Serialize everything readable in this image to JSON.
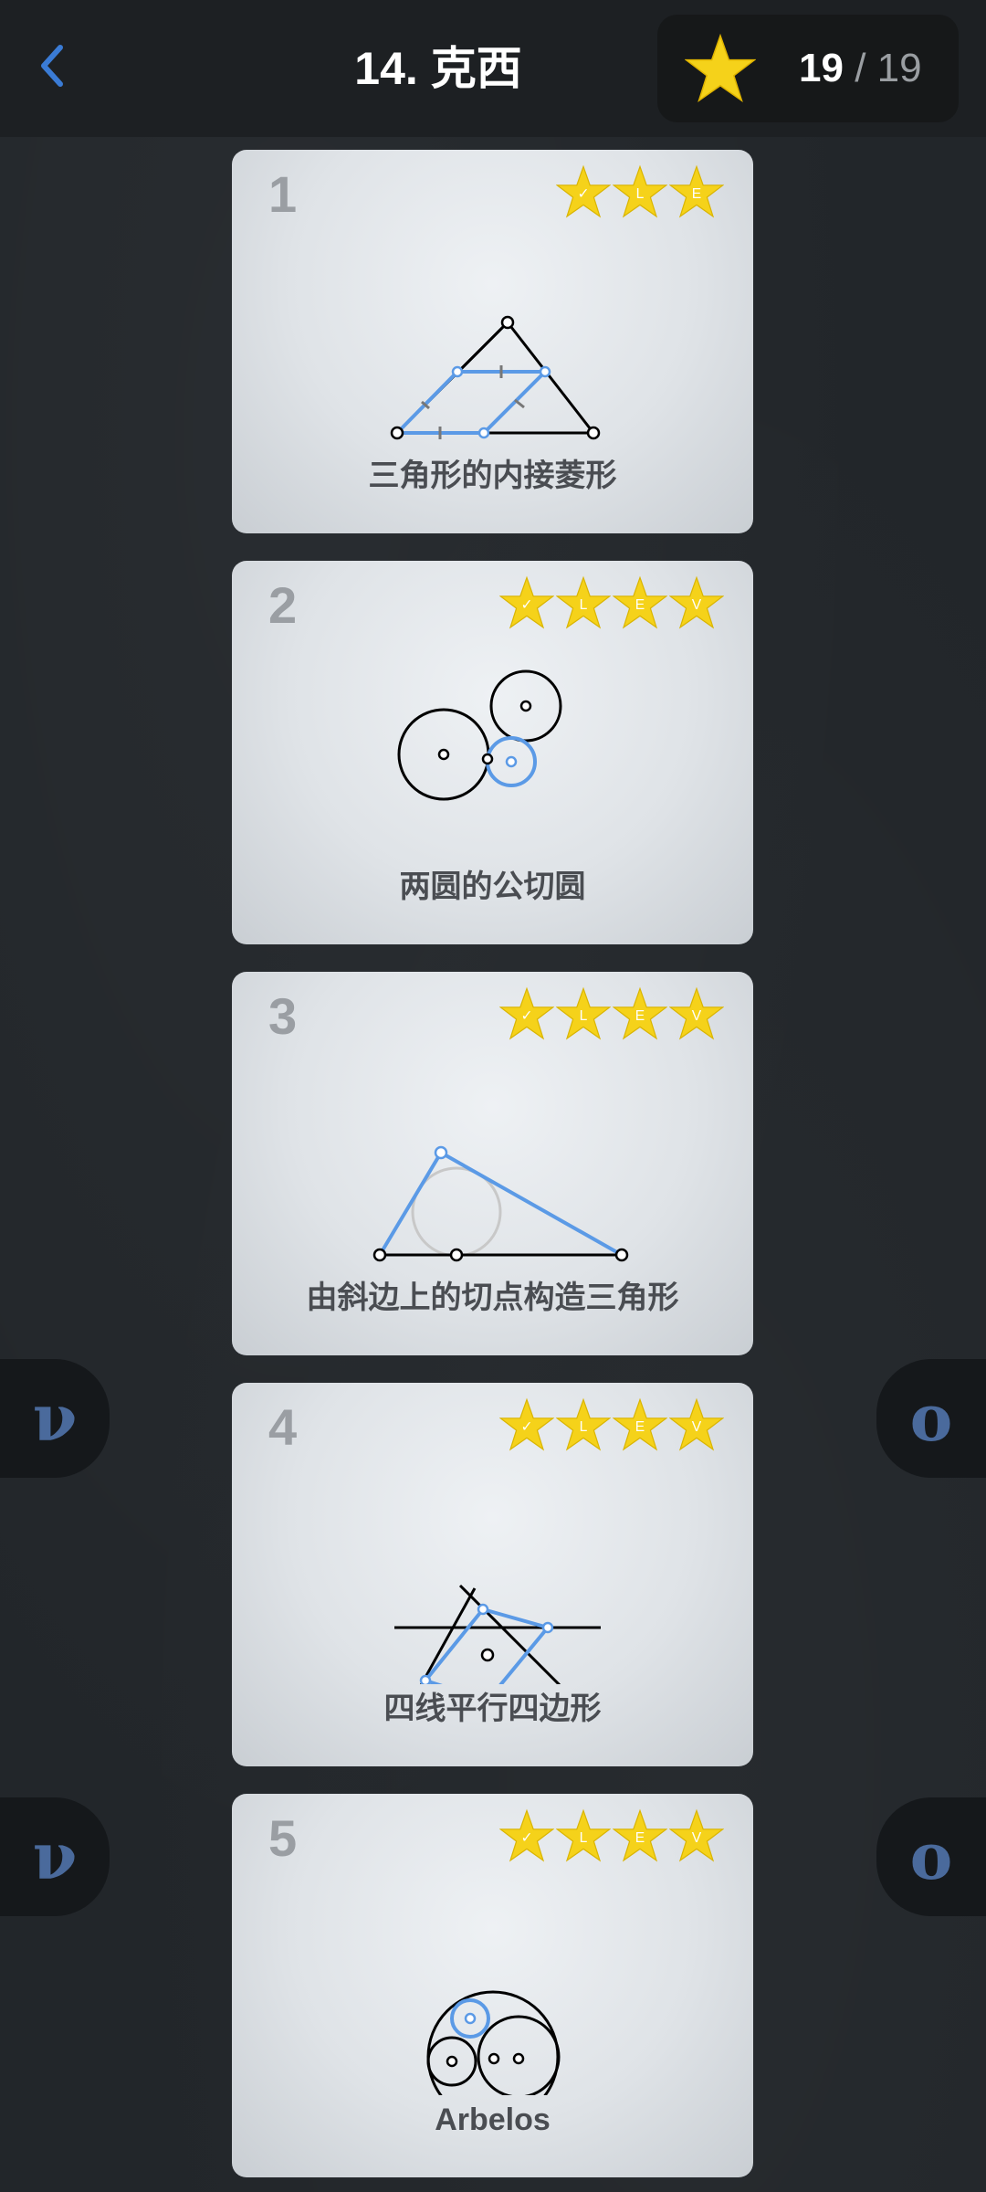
{
  "header": {
    "title": "14. 克西",
    "score_current": "19",
    "score_separator": "/",
    "score_total": "19"
  },
  "levels": [
    {
      "number": "1",
      "label": "三角形的内接菱形",
      "stars": [
        "✓",
        "L",
        "E"
      ]
    },
    {
      "number": "2",
      "label": "两圆的公切圆",
      "stars": [
        "✓",
        "L",
        "E",
        "V"
      ]
    },
    {
      "number": "3",
      "label": "由斜边上的切点构造三角形",
      "stars": [
        "✓",
        "L",
        "E",
        "V"
      ]
    },
    {
      "number": "4",
      "label": "四线平行四边形",
      "stars": [
        "✓",
        "L",
        "E",
        "V"
      ]
    },
    {
      "number": "5",
      "label": "Arbelos",
      "stars": [
        "✓",
        "L",
        "E",
        "V"
      ]
    }
  ],
  "side_tabs": {
    "left_glyph": "ν",
    "right_glyph": "ο"
  },
  "colors": {
    "accent_blue": "#5b9ae6",
    "star_gold": "#f5d21a",
    "back_arrow": "#3a7bd5"
  }
}
